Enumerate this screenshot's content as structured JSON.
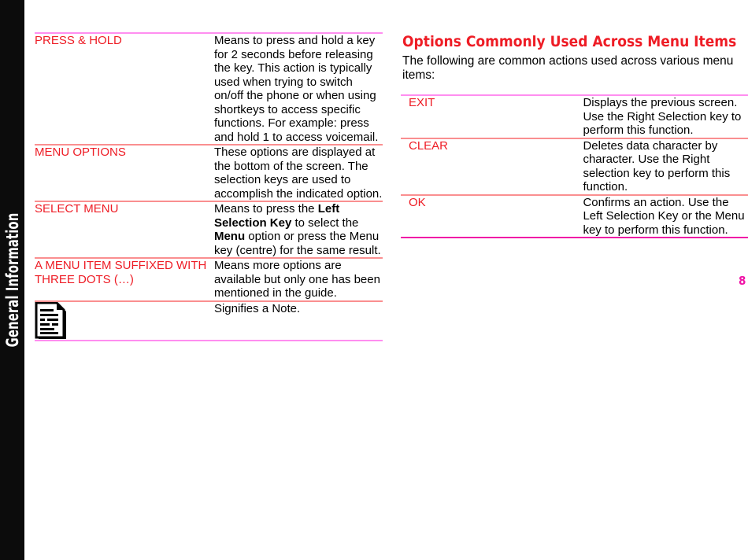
{
  "sidebar": {
    "label": "General Information"
  },
  "colors": {
    "term_red": "#ee1c25",
    "rule_outer_pink": "#ff8ef0",
    "rule_inner_salmon": "#fa8f90",
    "rule_strong_magenta": "#f013a6",
    "sidebar_black": "#0c0c0c",
    "body_text": "#000000"
  },
  "left_column": {
    "rows": [
      {
        "term": "PRESS & HOLD",
        "description_parts": [
          {
            "text": "Means to press and hold a key for 2 seconds before releasing the key. This action is typically used when trying to switch on/off the phone or when using shortkeys to access specific functions. For example: press and hold 1 to access voicemail.",
            "bold": false
          }
        ]
      },
      {
        "term": "MENU OPTIONS",
        "description_parts": [
          {
            "text": "These options are displayed at the bottom of the screen. The selection keys are used to accomplish the indicated option.",
            "bold": false
          }
        ]
      },
      {
        "term": "SELECT MENU",
        "description_parts": [
          {
            "text": "Means to press the ",
            "bold": false
          },
          {
            "text": "Left Selection Key",
            "bold": true
          },
          {
            "text": " to select the ",
            "bold": false
          },
          {
            "text": "Menu",
            "bold": true
          },
          {
            "text": " option or press the Menu key (centre) for the same result.",
            "bold": false
          }
        ]
      },
      {
        "term": "A MENU ITEM SUFFIXED WITH THREE DOTS (…)",
        "description_parts": [
          {
            "text": "Means more options are available but only one has been mentioned in the guide.",
            "bold": false
          }
        ]
      },
      {
        "term": "",
        "icon": "note-page-icon",
        "description_parts": [
          {
            "text": "Signifies a Note.",
            "bold": false
          }
        ]
      }
    ]
  },
  "right_column": {
    "heading": "Options Commonly Used Across Menu Items",
    "intro": "The following are common actions used across various menu items:",
    "rows": [
      {
        "term": "EXIT",
        "description_parts": [
          {
            "text": "Displays the previous screen. Use the Right Selection key to perform this function.",
            "bold": false
          }
        ]
      },
      {
        "term": "CLEAR",
        "description_parts": [
          {
            "text": "Deletes data character by character. Use the Right selection key to perform this function.",
            "bold": false
          }
        ]
      },
      {
        "term": "OK",
        "description_parts": [
          {
            "text": "Confirms an action. Use the Left Selection Key or the Menu key to perform this function.",
            "bold": false
          }
        ]
      }
    ]
  },
  "page_number": "8"
}
